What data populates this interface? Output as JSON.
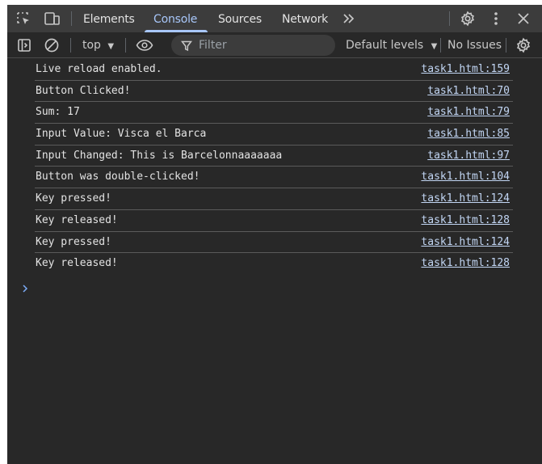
{
  "tabs": [
    {
      "label": "Elements"
    },
    {
      "label": "Console"
    },
    {
      "label": "Sources"
    },
    {
      "label": "Network"
    }
  ],
  "toolbar": {
    "context": "top",
    "filter_placeholder": "Filter",
    "levels": "Default levels",
    "issues": "No Issues"
  },
  "messages": [
    {
      "text": "Live reload enabled.",
      "source": "task1.html:159"
    },
    {
      "text": "Button Clicked!",
      "source": "task1.html:70"
    },
    {
      "text": "Sum: 17",
      "source": "task1.html:79"
    },
    {
      "text": "Input Value: Visca el Barca",
      "source": "task1.html:85"
    },
    {
      "text": "Input Changed: This is Barcelonnaaaaaaa",
      "source": "task1.html:97"
    },
    {
      "text": "Button was double-clicked!",
      "source": "task1.html:104"
    },
    {
      "text": "Key pressed!",
      "source": "task1.html:124"
    },
    {
      "text": "Key released!",
      "source": "task1.html:128"
    },
    {
      "text": "Key pressed!",
      "source": "task1.html:124"
    },
    {
      "text": "Key released!",
      "source": "task1.html:128"
    }
  ],
  "icons": {
    "inspect": "inspect-element-icon",
    "device": "device-toolbar-icon",
    "more_tabs": "chevron-double-right-icon",
    "settings": "gear-icon",
    "menu": "vertical-dots-icon",
    "close": "close-icon",
    "sidebar": "sidebar-toggle-icon",
    "clear": "clear-console-icon",
    "eye": "eye-icon",
    "filter": "funnel-icon",
    "prompt": "chevron-right-icon"
  },
  "colors": {
    "panel_bg": "#282828",
    "bar_bg": "#3c3c3c",
    "active_tab": "#a8c7fa",
    "text": "#e3e3e3",
    "link": "#c2d6f4"
  }
}
